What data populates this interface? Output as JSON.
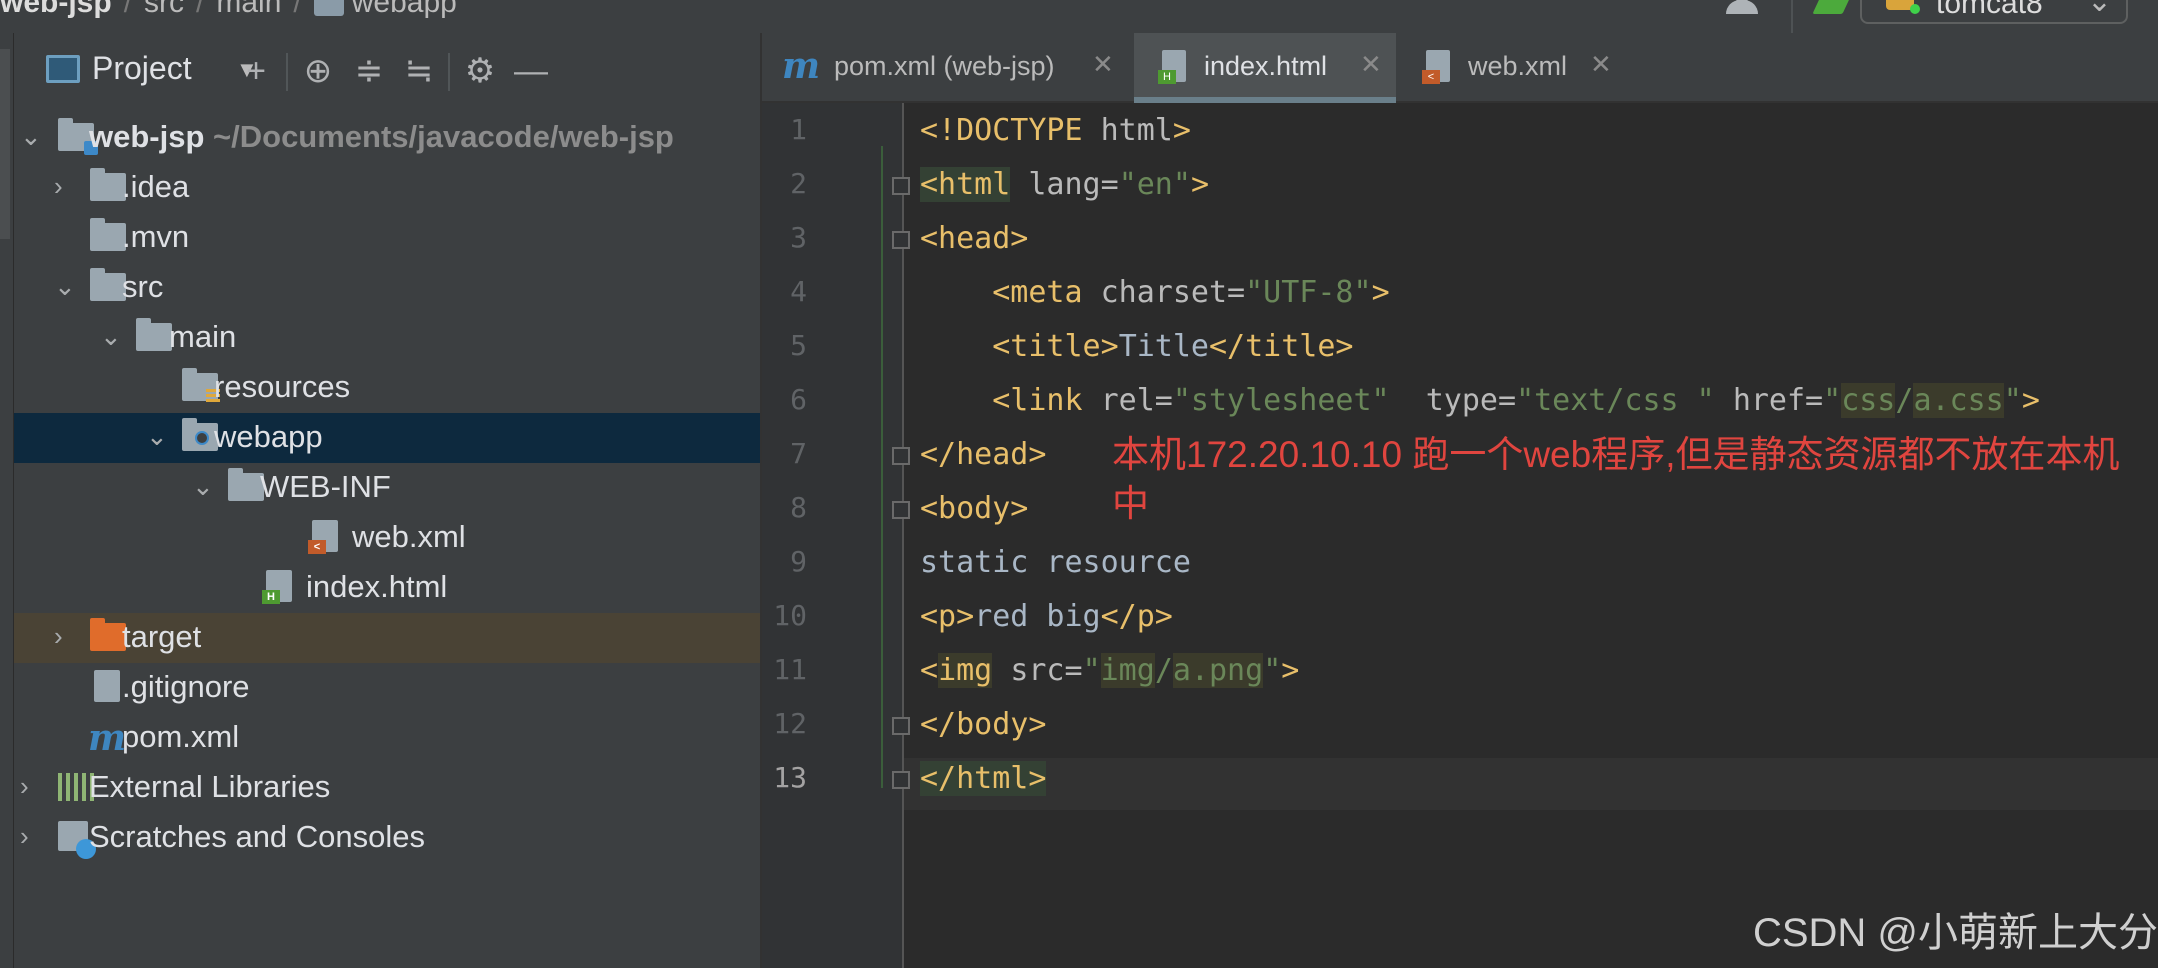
{
  "breadcrumb": {
    "project": "web-jsp",
    "parts": [
      "src",
      "main",
      "webapp"
    ]
  },
  "run_config": {
    "name": "tomcat8"
  },
  "project_panel": {
    "title": "Project",
    "tree": [
      {
        "label": "web-jsp",
        "path": "~/Documents/javacode/web-jsp",
        "depth": 0,
        "expanded": true,
        "icon": "module-folder-icon"
      },
      {
        "label": ".idea",
        "depth": 1,
        "expanded": false,
        "icon": "folder-icon"
      },
      {
        "label": ".mvn",
        "depth": 1,
        "icon": "folder-icon"
      },
      {
        "label": "src",
        "depth": 1,
        "expanded": true,
        "icon": "folder-icon"
      },
      {
        "label": "main",
        "depth": 2,
        "expanded": true,
        "icon": "folder-icon"
      },
      {
        "label": "resources",
        "depth": 3,
        "icon": "resources-folder-icon"
      },
      {
        "label": "webapp",
        "depth": 3,
        "expanded": true,
        "selected": true,
        "icon": "web-folder-icon"
      },
      {
        "label": "WEB-INF",
        "depth": 4,
        "expanded": true,
        "icon": "folder-icon"
      },
      {
        "label": "web.xml",
        "depth": 5,
        "icon": "xml-file-icon"
      },
      {
        "label": "index.html",
        "depth": 4,
        "icon": "html-file-icon"
      },
      {
        "label": "target",
        "depth": 1,
        "expanded": false,
        "icon": "excluded-folder-icon"
      },
      {
        "label": ".gitignore",
        "depth": 1,
        "icon": "gitignore-file-icon"
      },
      {
        "label": "pom.xml",
        "depth": 1,
        "icon": "maven-icon"
      },
      {
        "label": "External Libraries",
        "depth": 0,
        "expanded": false,
        "icon": "libraries-icon"
      },
      {
        "label": "Scratches and Consoles",
        "depth": 0,
        "expanded": false,
        "icon": "scratches-icon"
      }
    ]
  },
  "tabs": [
    {
      "label": "pom.xml (web-jsp)",
      "active": false,
      "icon": "maven-icon"
    },
    {
      "label": "index.html",
      "active": true,
      "icon": "html-file-icon"
    },
    {
      "label": "web.xml",
      "active": false,
      "icon": "xml-file-icon"
    }
  ],
  "editor": {
    "current_line": 13,
    "line_numbers": [
      "1",
      "2",
      "3",
      "4",
      "5",
      "6",
      "7",
      "8",
      "9",
      "10",
      "11",
      "12",
      "13"
    ],
    "annotation": "本机172.20.10.10  跑一个web程序,但是静态资源都不放在本机中"
  },
  "watermark": "CSDN @小萌新上大分",
  "colors": {
    "annotation": "#e0453f",
    "selection": "#0d293e",
    "tag": "#e8bf6a",
    "string": "#6a8759"
  }
}
